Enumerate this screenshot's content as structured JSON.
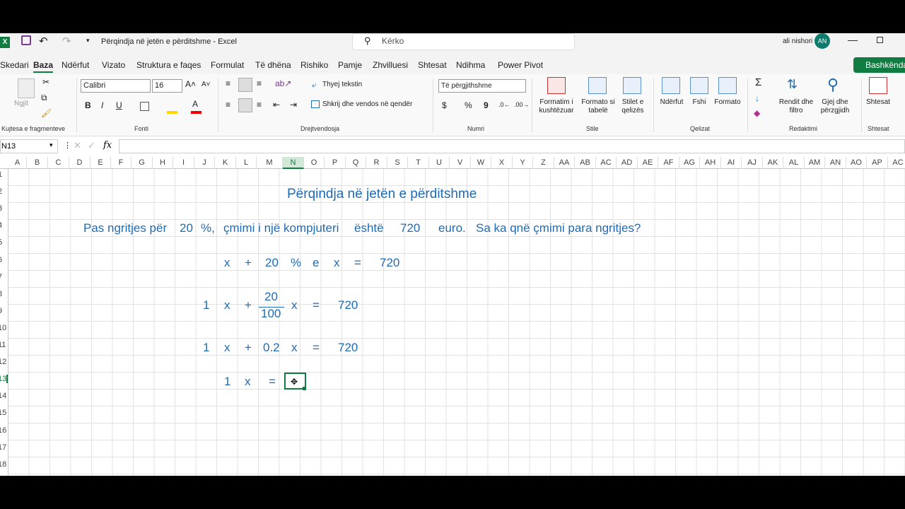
{
  "window": {
    "title": "Përqindja në jetën e përditshme  -  Excel",
    "search_placeholder": "Kërko",
    "user": "ali nishori",
    "initials": "AN",
    "app_letter": "X"
  },
  "menu": {
    "tabs": [
      "Skedari",
      "Baza",
      "Ndërfut",
      "Vizato",
      "Struktura e faqes",
      "Formulat",
      "Të dhëna",
      "Rishiko",
      "Pamje",
      "Zhvilluesi",
      "Shtesat",
      "Ndihma",
      "Power Pivot"
    ],
    "share": "Bashkënda"
  },
  "ribbon": {
    "clipboard": {
      "paste": "Ngjit",
      "label": "Kujtesa e fragmenteve"
    },
    "font": {
      "name": "Calibri",
      "size": "16",
      "bold": "B",
      "italic": "I",
      "underline": "U",
      "label": "Fonti"
    },
    "alignment": {
      "wrap": "Thyej tekstin",
      "merge": "Shkrij dhe vendos në qendër",
      "label": "Drejtvendosja"
    },
    "number": {
      "format": "Të përgjithshme",
      "currency": "$",
      "percent": "%",
      "comma": "9",
      "label": "Numri"
    },
    "styles": {
      "conditional": "Formatim i kushtëzuar",
      "table": "Formato si tabelë",
      "cell_styles": "Stilet e qelizës",
      "label": "Stile"
    },
    "cells": {
      "insert": "Ndërfut",
      "delete": "Fshi",
      "format": "Formato",
      "label": "Qelizat"
    },
    "editing": {
      "sort": "Rendit dhe filtro",
      "find": "Gjej dhe përzgjidh",
      "sigma": "Σ",
      "label": "Redaktimi"
    },
    "addins": {
      "addins": "Shtesat",
      "label": "Shtesat"
    }
  },
  "formula_bar": {
    "name_box": "N13",
    "fx": "fx",
    "value": ""
  },
  "columns": [
    "A",
    "B",
    "C",
    "D",
    "E",
    "F",
    "G",
    "H",
    "I",
    "J",
    "K",
    "L",
    "M",
    "N",
    "O",
    "P",
    "Q",
    "R",
    "S",
    "T",
    "U",
    "V",
    "W",
    "X",
    "Y",
    "Z",
    "AA",
    "AB",
    "AC",
    "AD",
    "AE",
    "AF",
    "AG",
    "AH",
    "AI",
    "AJ",
    "AK",
    "AL",
    "AM",
    "AN",
    "AO",
    "AP",
    "AC"
  ],
  "rows": [
    "1",
    "2",
    "3",
    "4",
    "5",
    "6",
    "7",
    "8",
    "9",
    "10",
    "11",
    "12",
    "13",
    "14",
    "15",
    "16",
    "17",
    "18"
  ],
  "sheet": {
    "title": "Përqindja në jetën e përditshme",
    "r4": {
      "a": "Pas ngritjes për",
      "b": "20",
      "c": "%,",
      "d": "çmimi i një kompjuteri",
      "e": "është",
      "f": "720",
      "g": "euro.",
      "h": "Sa ka qnë çmimi para ngritjes?"
    },
    "r6": {
      "a": "x",
      "b": "+",
      "c": "20",
      "d": "%",
      "e": "e",
      "f": "x",
      "g": "=",
      "h": "720"
    },
    "r8": {
      "num": "20",
      "den": "100"
    },
    "r9": {
      "a": "1",
      "b": "x",
      "c": "+",
      "d": "x",
      "e": "=",
      "f": "720"
    },
    "r11": {
      "a": "1",
      "b": "x",
      "c": "+",
      "d": "0.2",
      "e": "x",
      "f": "=",
      "g": "720"
    },
    "r13": {
      "a": "1",
      "b": "x",
      "c": "="
    }
  },
  "colors": {
    "accent": "#107c41",
    "text_blue": "#1f6bb5"
  }
}
